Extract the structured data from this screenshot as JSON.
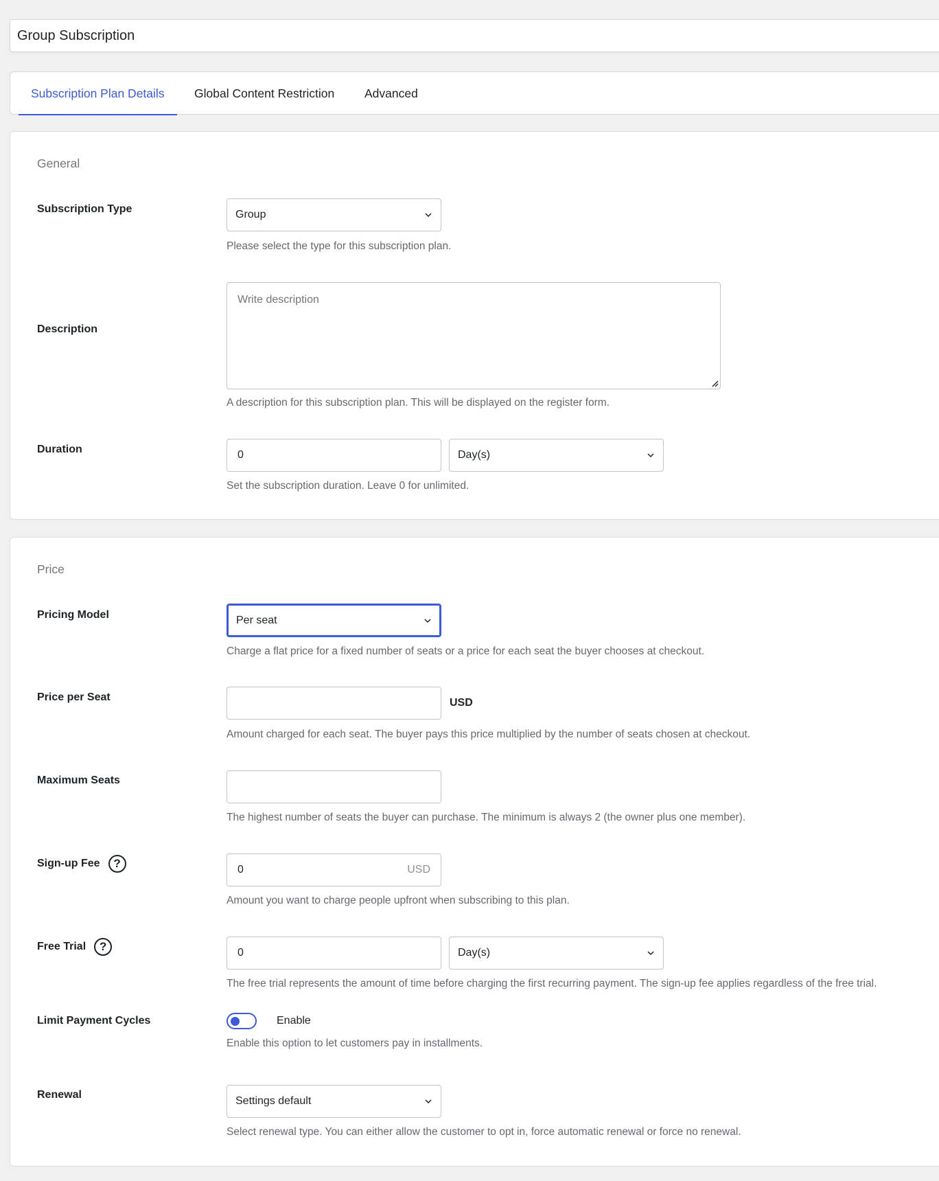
{
  "plan_title": "Group Subscription",
  "tabs": [
    {
      "label": "Subscription Plan Details",
      "active": true
    },
    {
      "label": "Global Content Restriction",
      "active": false
    },
    {
      "label": "Advanced",
      "active": false
    }
  ],
  "general": {
    "title": "General",
    "subscription_type": {
      "label": "Subscription Type",
      "value": "Group",
      "help": "Please select the type for this subscription plan."
    },
    "description": {
      "label": "Description",
      "placeholder": "Write description",
      "help": "A description for this subscription plan. This will be displayed on the register form."
    },
    "duration": {
      "label": "Duration",
      "value": "0",
      "unit": "Day(s)",
      "help": "Set the subscription duration. Leave 0 for unlimited."
    }
  },
  "price": {
    "title": "Price",
    "pricing_model": {
      "label": "Pricing Model",
      "value": "Per seat",
      "help": "Charge a flat price for a fixed number of seats or a price for each seat the buyer chooses at checkout."
    },
    "price_per_seat": {
      "label": "Price per Seat",
      "value": "",
      "currency": "USD",
      "help": "Amount charged for each seat. The buyer pays this price multiplied by the number of seats chosen at checkout."
    },
    "maximum_seats": {
      "label": "Maximum Seats",
      "value": "",
      "help": "The highest number of seats the buyer can purchase. The minimum is always 2 (the owner plus one member)."
    },
    "signup_fee": {
      "label": "Sign-up Fee",
      "value": "0",
      "currency": "USD",
      "help": "Amount you want to charge people upfront when subscribing to this plan."
    },
    "free_trial": {
      "label": "Free Trial",
      "value": "0",
      "unit": "Day(s)",
      "help": "The free trial represents the amount of time before charging the first recurring payment. The sign-up fee applies regardless of the free trial."
    },
    "limit_payment_cycles": {
      "label": "Limit Payment Cycles",
      "toggle_label": "Enable",
      "help": "Enable this option to let customers pay in installments."
    },
    "renewal": {
      "label": "Renewal",
      "value": "Settings default",
      "help": "Select renewal type. You can either allow the customer to opt in, force automatic renewal or force no renewal."
    }
  },
  "help_glyph": "?",
  "colors": {
    "accent": "#3c5bd4",
    "background": "#f0f0f1",
    "card": "#ffffff",
    "help_text": "#646970"
  }
}
